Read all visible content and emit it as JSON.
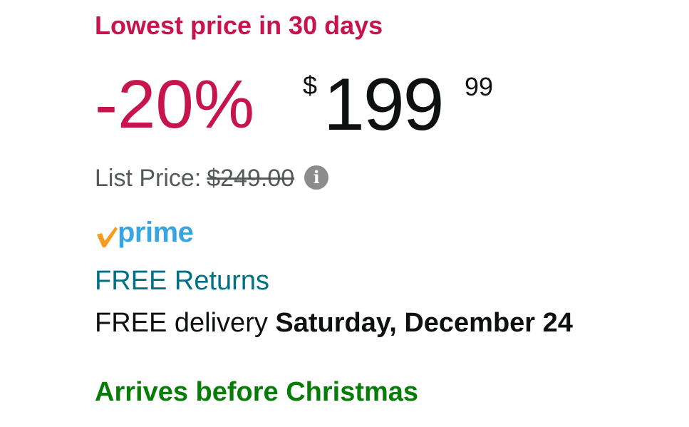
{
  "deal_badge": {
    "text": "Lowest price in 30 days",
    "color": "#c7144c"
  },
  "price": {
    "discount": "-20%",
    "discount_color": "#c7144c",
    "currency_symbol": "$",
    "whole": "199",
    "fraction": "99",
    "color": "#0f1111"
  },
  "list_price": {
    "label": "List Price:",
    "value": "$249.00",
    "info_icon": "info-circle-icon",
    "info_icon_color": "#8c8c8c",
    "info_icon_glyph": "i"
  },
  "prime": {
    "icon": "prime-check-icon",
    "word": "prime",
    "check_color": "#f79c1e",
    "word_color": "#36a5e0"
  },
  "returns": {
    "label": "FREE Returns",
    "color": "#007185"
  },
  "delivery": {
    "prefix": "FREE delivery",
    "date": "Saturday, December 24"
  },
  "arrival": {
    "text": "Arrives before Christmas",
    "color": "#067d06"
  }
}
